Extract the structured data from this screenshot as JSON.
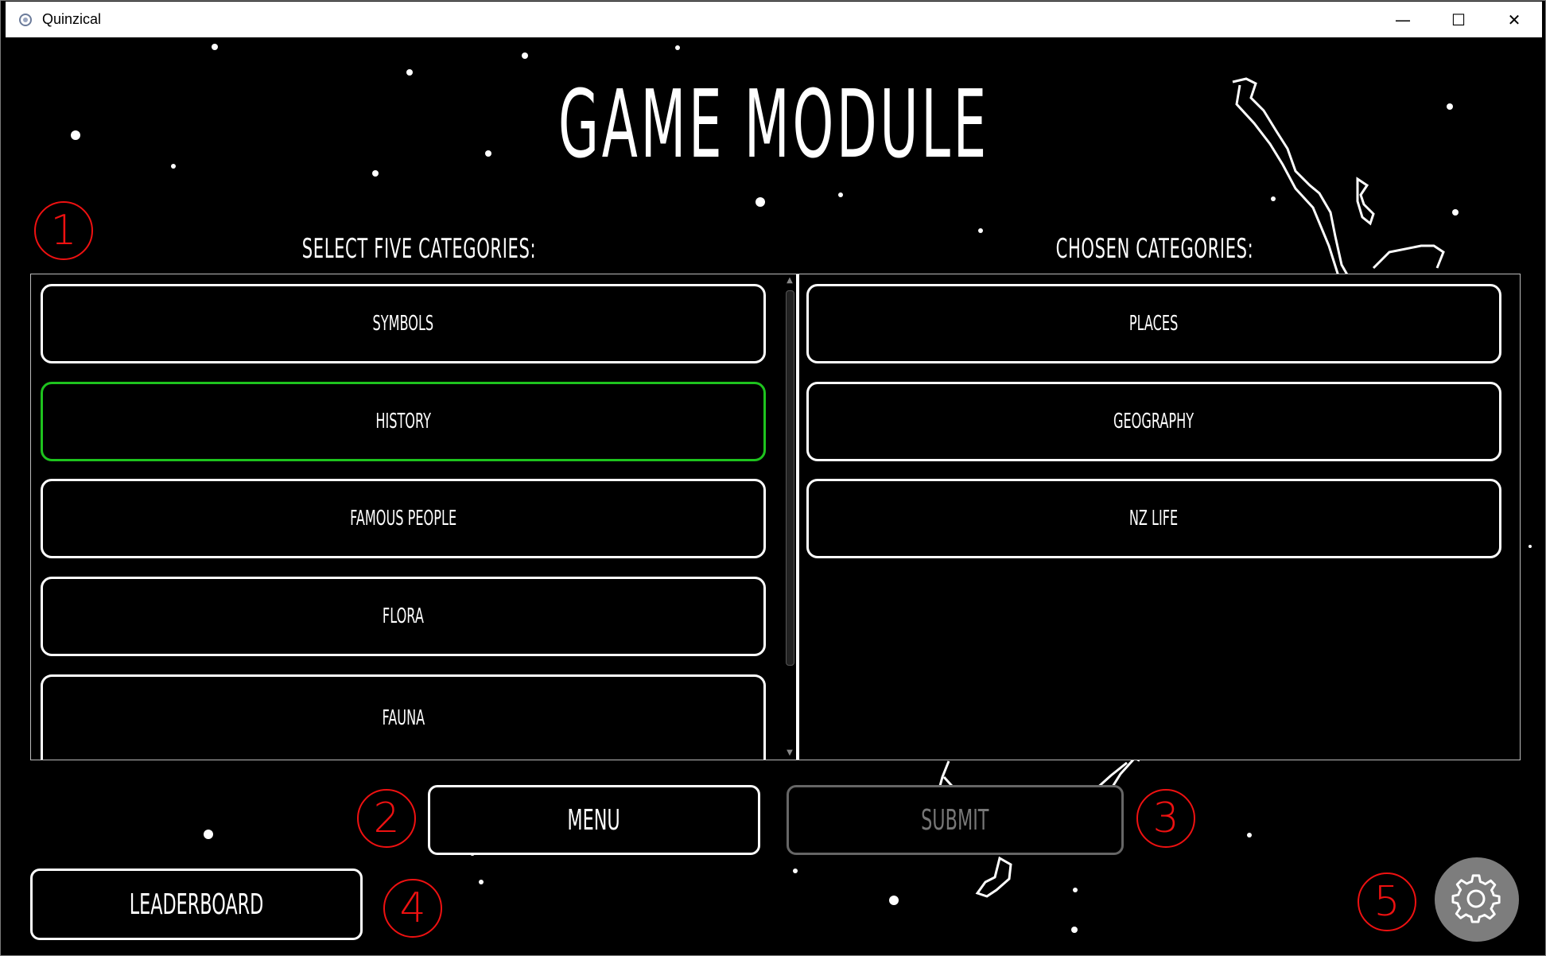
{
  "window": {
    "title": "Quinzical",
    "controls": {
      "minimize": "—",
      "maximize": "☐",
      "close": "✕"
    }
  },
  "header": {
    "title": "GAME MODULE"
  },
  "select_panel": {
    "label": "SELECT FIVE CATEGORIES:",
    "items": [
      {
        "label": "SYMBOLS",
        "selected": false
      },
      {
        "label": "HISTORY",
        "selected": true
      },
      {
        "label": "FAMOUS PEOPLE",
        "selected": false
      },
      {
        "label": "FLORA",
        "selected": false
      },
      {
        "label": "FAUNA",
        "selected": false
      }
    ]
  },
  "chosen_panel": {
    "label": "CHOSEN CATEGORIES:",
    "items": [
      {
        "label": "PLACES"
      },
      {
        "label": "GEOGRAPHY"
      },
      {
        "label": "NZ LIFE"
      }
    ]
  },
  "buttons": {
    "menu": "MENU",
    "submit": "SUBMIT",
    "leaderboard": "LEADERBOARD"
  },
  "markers": [
    "1",
    "2",
    "3",
    "4",
    "5"
  ],
  "colors": {
    "background": "#000000",
    "foreground": "#ffffff",
    "selected_border": "#1ec31e",
    "annotation": "#ee1111",
    "settings_button": "#7d7d7d"
  },
  "icons": {
    "app": "quinzical-app-icon",
    "settings": "gear-icon"
  }
}
